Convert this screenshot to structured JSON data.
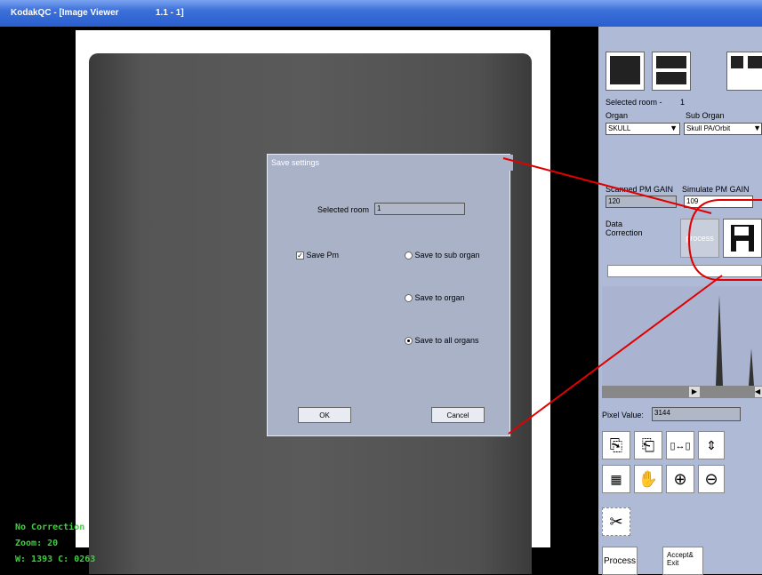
{
  "window": {
    "title": "KodakQC - [Image Viewer",
    "title_extra": "1.1 - 1]"
  },
  "viewer": {
    "status_correction": "No Correction",
    "status_zoom": "Zoom: 20",
    "status_wc": "W: 1393  C: 0263"
  },
  "panel": {
    "selected_room_label": "Selected room -",
    "selected_room_value": "1",
    "organ_label": "Organ",
    "organ_value": "SKULL",
    "sub_organ_label": "Sub Organ",
    "sub_organ_value": "Skull PA/Orbit",
    "scanned_pm_gain_label": "Scanned PM GAIN",
    "scanned_pm_gain_value": "120",
    "simulate_pm_gain_label": "Simulate PM GAIN",
    "simulate_pm_gain_value": "109",
    "data_correction_label": "Data Correction",
    "process_button_label": "process",
    "pixel_value_label": "Pixel Value:",
    "pixel_value": "3144",
    "process_big_label": "Process",
    "accept_exit_label": "Accept& Exit"
  },
  "dialog": {
    "title": "Save settings",
    "selected_room_label": "Selected room",
    "selected_room_value": "1",
    "save_pm_label": "Save Pm",
    "save_pm_checked": true,
    "radio_sub_organ": "Save to sub organ",
    "radio_organ": "Save to organ",
    "radio_all_organs": "Save to all organs",
    "selected_radio": "all_organs",
    "ok_label": "OK",
    "cancel_label": "Cancel"
  },
  "colors": {
    "annotation": "#e00000",
    "status_text": "#3cd23c"
  }
}
